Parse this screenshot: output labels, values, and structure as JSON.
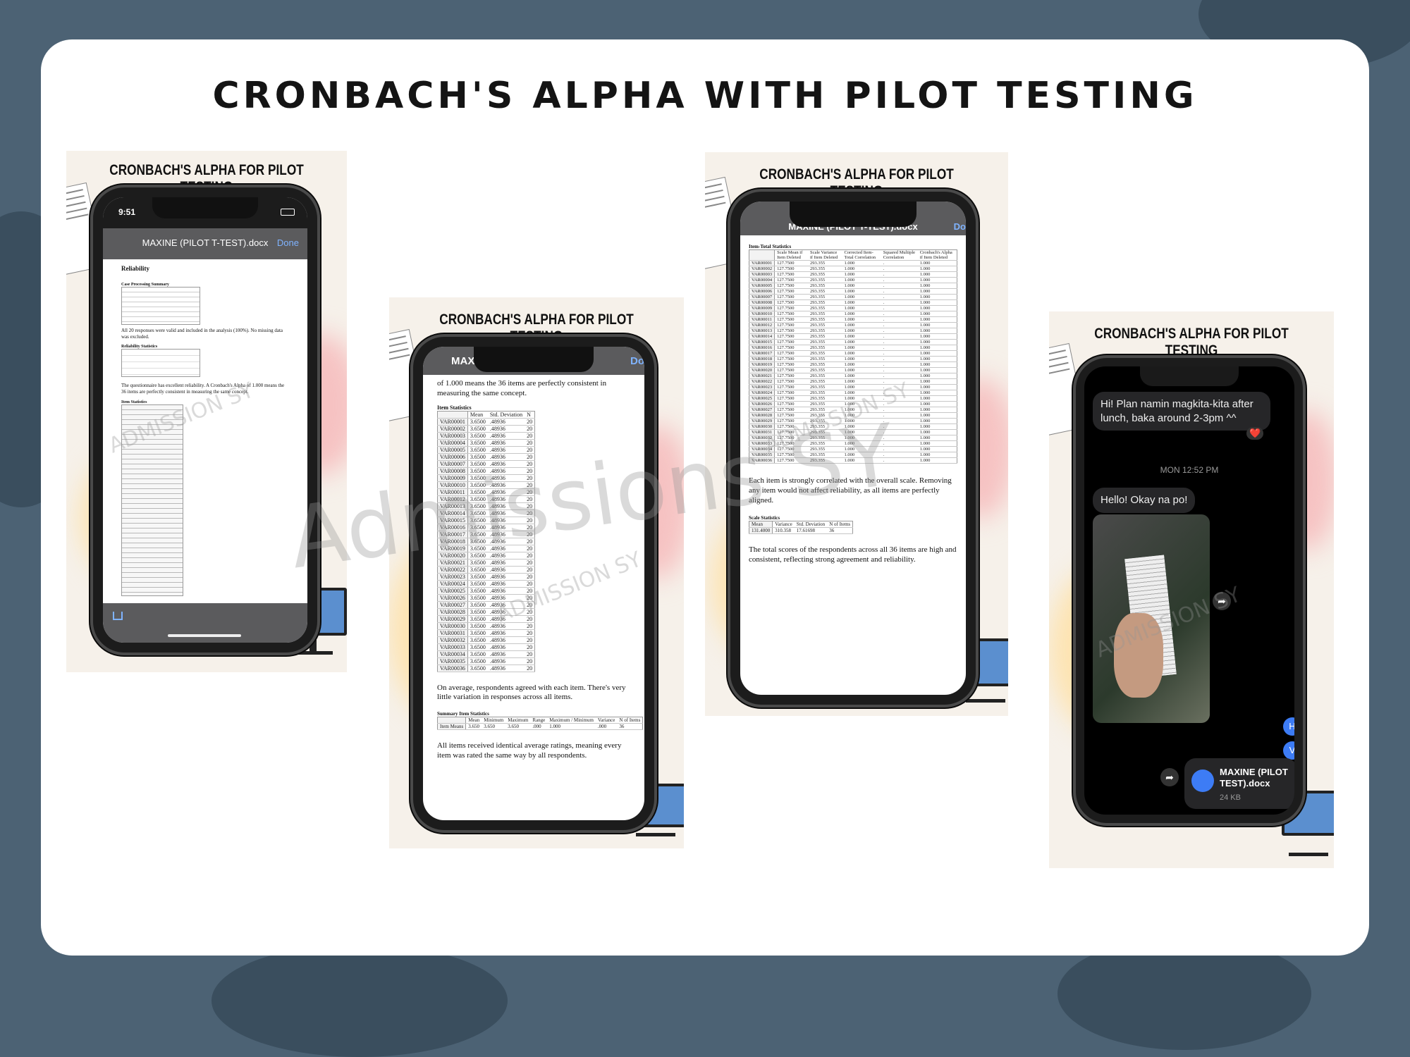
{
  "main_title": "CRONBACH'S ALPHA WITH PILOT TESTING",
  "panel_title": "CRONBACH'S ALPHA FOR PILOT TESTING",
  "watermark_big": "Admissions SY",
  "watermark_small": "ADMISSION SY",
  "colors": {
    "page_bg": "#4c6274",
    "card_bg": "#ffffff",
    "phone_frame": "#1c1c1c",
    "link_blue": "#7fb3ff"
  },
  "phone1": {
    "time": "9:51",
    "filename": "MAXINE (PILOT T-TEST).docx",
    "done": "Done",
    "heading": "Reliability",
    "case_summary_title": "Case Processing Summary",
    "para1": "All 20 responses were valid and included in the analysis (100%). No missing data was excluded.",
    "reliability_title": "Reliability Statistics",
    "para2": "The questionnaire has excellent reliability. A Cronbach's Alpha of 1.000 means the 36 items are perfectly consistent in measuring the same concept.",
    "item_stats_title": "Item Statistics",
    "share_icon": "share-icon"
  },
  "phone2": {
    "filename_partial": "MAXI",
    "done_partial": "Do",
    "para_top": "of 1.000 means the 36 items are perfectly consistent in measuring the same concept.",
    "table_title": "Item Statistics",
    "headers": [
      "",
      "Mean",
      "Std. Deviation",
      "N"
    ],
    "row_mean": "3.6500",
    "row_sd": ".48936",
    "row_n": "20",
    "para_mid": "On average, respondents agreed with each item. There's very little variation in responses across all items.",
    "summary_title": "Summary Item Statistics",
    "summary_headers": [
      "",
      "Mean",
      "Minimum",
      "Maximum",
      "Range",
      "Maximum / Minimum",
      "Variance",
      "N of Items"
    ],
    "summary_row": [
      "Item Means",
      "3.650",
      "3.650",
      "3.650",
      ".000",
      "1.000",
      ".000",
      "36"
    ],
    "para_bottom": "All items received identical average ratings, meaning every item was rated the same way by all respondents."
  },
  "phone3": {
    "filename": "MAXINE (PILOT T-TEST).docx",
    "done_partial": "Do",
    "table_title": "Item-Total Statistics",
    "headers": [
      "",
      "Scale Mean if Item Deleted",
      "Scale Variance if Item Deleted",
      "Corrected Item-Total Correlation",
      "Squared Multiple Correlation",
      "Cronbach's Alpha if Item Deleted"
    ],
    "row_mean": "127.7500",
    "row_var": "293.355",
    "row_corr": "1.000",
    "row_sq": ".",
    "row_alpha": "1.000",
    "para_mid": "Each item is strongly correlated with the overall scale. Removing any item would not affect reliability, as all items are perfectly aligned.",
    "scale_title": "Scale Statistics",
    "scale_headers": [
      "Mean",
      "Variance",
      "Std. Deviation",
      "N of Items"
    ],
    "scale_row": [
      "131.4000",
      "310.358",
      "17.61698",
      "36"
    ],
    "para_bottom": "The total scores of the respondents across all 36 items are high and consistent, reflecting strong agreement and reliability."
  },
  "phone4": {
    "msg1": "Hi! Plan namin magkita-kita after lunch, baka around 2-3pm ^^",
    "reaction": "❤️",
    "timestamp": "MON 12:52 PM",
    "msg2": "Hello! Okay na po!",
    "file_name": "MAXINE (PILOT TEST).docx",
    "file_size": "24 KB",
    "side_bubble_1": "H",
    "side_bubble_2": "V"
  }
}
